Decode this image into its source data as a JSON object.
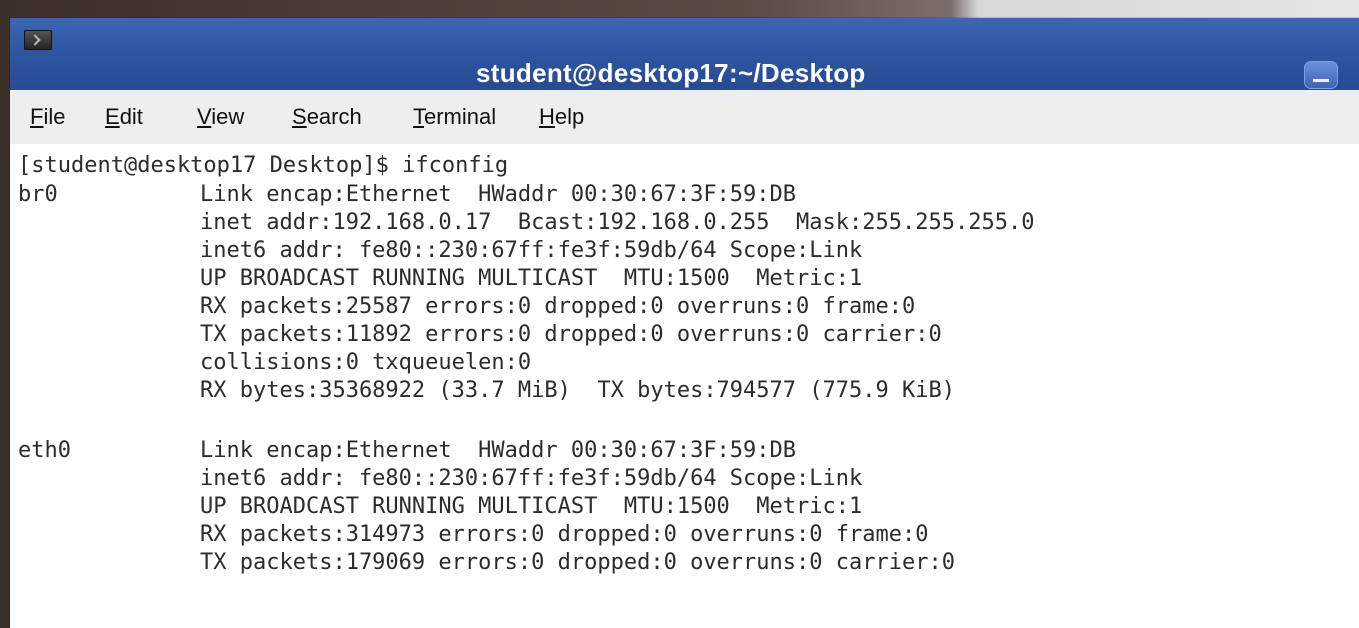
{
  "window": {
    "title": "student@desktop17:~/Desktop"
  },
  "menubar": {
    "items": [
      "File",
      "Edit",
      "View",
      "Search",
      "Terminal",
      "Help"
    ]
  },
  "terminal": {
    "prompt_line": "[student@desktop17 Desktop]$ ifconfig",
    "interfaces": [
      {
        "name": "br0",
        "lines": [
          "Link encap:Ethernet  HWaddr 00:30:67:3F:59:DB",
          "inet addr:192.168.0.17  Bcast:192.168.0.255  Mask:255.255.255.0",
          "inet6 addr: fe80::230:67ff:fe3f:59db/64 Scope:Link",
          "UP BROADCAST RUNNING MULTICAST  MTU:1500  Metric:1",
          "RX packets:25587 errors:0 dropped:0 overruns:0 frame:0",
          "TX packets:11892 errors:0 dropped:0 overruns:0 carrier:0",
          "collisions:0 txqueuelen:0",
          "RX bytes:35368922 (33.7 MiB)  TX bytes:794577 (775.9 KiB)"
        ]
      },
      {
        "name": "eth0",
        "lines": [
          "Link encap:Ethernet  HWaddr 00:30:67:3F:59:DB",
          "inet6 addr: fe80::230:67ff:fe3f:59db/64 Scope:Link",
          "UP BROADCAST RUNNING MULTICAST  MTU:1500  Metric:1",
          "RX packets:314973 errors:0 dropped:0 overruns:0 frame:0",
          "TX packets:179069 errors:0 dropped:0 overruns:0 carrier:0"
        ]
      }
    ]
  },
  "icons": {
    "app": "terminal-icon",
    "minimize": "minimize-icon"
  },
  "colors": {
    "titlebar": "#2f56a2",
    "menubar": "#eeeeec",
    "terminal_bg": "#ffffff",
    "terminal_text": "#2c2c2c"
  }
}
